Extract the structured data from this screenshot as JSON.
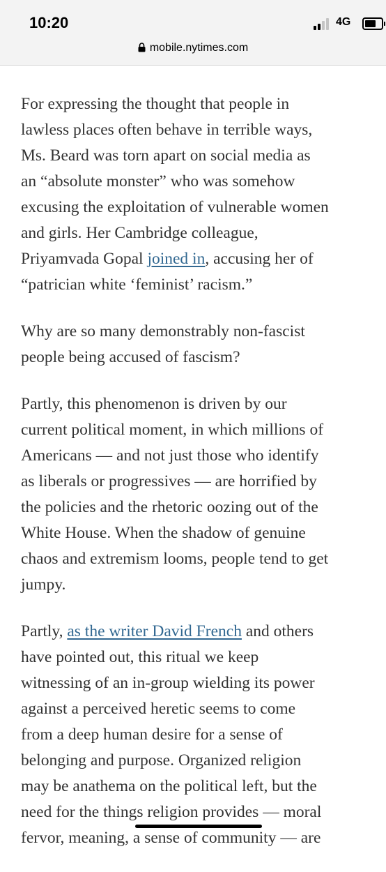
{
  "status_bar": {
    "time": "10:20",
    "network": "4G",
    "signal_bars_active": 2,
    "signal_bars_total": 4,
    "battery_level": 0.85
  },
  "browser": {
    "url": "mobile.nytimes.com"
  },
  "article": {
    "p1": {
      "l1": "For expressing the thought that people in",
      "l2": "lawless places often behave in terrible ways,",
      "l3": "Ms. Beard was torn apart on social media as",
      "l4": "an “absolute monster” who was somehow",
      "l5": "excusing the exploitation of vulnerable women",
      "l6": "and girls. Her Cambridge colleague,",
      "l7_before": "Priyamvada Gopal ",
      "l7_link": "joined in",
      "l7_after": ", accusing her of",
      "l8": "“patrician white ‘feminist’ racism.”"
    },
    "p2": {
      "l1": "Why are so many demonstrably non-fascist",
      "l2": "people being accused of fascism?"
    },
    "p3": {
      "l1": "Partly, this phenomenon is driven by our",
      "l2": "current political moment, in which millions of",
      "l3": "Americans — and not just those who identify",
      "l4": "as liberals or progressives — are horrified by",
      "l5": "the policies and the rhetoric oozing out of the",
      "l6": "White House. When the shadow of genuine",
      "l7": "chaos and extremism looms, people tend to get",
      "l8": "jumpy."
    },
    "p4": {
      "l1_before": "Partly, ",
      "l1_link": "as the writer David French",
      "l1_after": " and others",
      "l2": "have pointed out, this ritual we keep",
      "l3": "witnessing of an in-group wielding its power",
      "l4": "against a perceived heretic seems to come",
      "l5": "from a deep human desire for a sense of",
      "l6": "belonging and purpose. Organized religion",
      "l7": "may be anathema on the political left, but the",
      "l8": "need for the things religion provides — moral",
      "l9": "fervor, meaning, a sense of community — are"
    }
  },
  "colors": {
    "link": "#326891",
    "body_text": "#333333",
    "toolbar_bg": "#f3f3f3"
  },
  "icons": {
    "lock": "lock-icon",
    "signal": "cellular-signal-icon",
    "battery": "battery-icon"
  }
}
